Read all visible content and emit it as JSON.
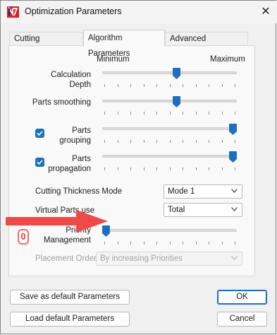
{
  "window": {
    "title": "Optimization Parameters",
    "close_glyph": "✕"
  },
  "tabs": [
    {
      "label": "Cutting Parameters",
      "active": false
    },
    {
      "label": "Algorithm Parameters",
      "active": true
    },
    {
      "label": "Advanced Parameters",
      "active": false
    }
  ],
  "scale": {
    "min_label": "Minimum",
    "max_label": "Maximum"
  },
  "sliders": {
    "calculation_depth": {
      "label_line1": "Calculation",
      "label_line2": "Depth",
      "value_fraction": 0.55
    },
    "parts_smoothing": {
      "label": "Parts smoothing",
      "value_fraction": 0.55
    },
    "parts_grouping": {
      "label_line1": "Parts",
      "label_line2": "grouping",
      "checked": true,
      "value_fraction": 1.0
    },
    "parts_propagation": {
      "label_line1": "Parts",
      "label_line2": "propagation",
      "checked": true,
      "value_fraction": 1.0
    },
    "priority_management": {
      "label_line1": "Priority",
      "label_line2": "Management",
      "value_fraction": 0.0
    }
  },
  "fields": {
    "cutting_thickness_mode": {
      "label": "Cutting Thickness Mode",
      "value": "Mode 1"
    },
    "virtual_parts_use": {
      "label": "Virtual Parts use",
      "value": "Total"
    },
    "placement_order": {
      "label": "Placement Order",
      "value": "By increasing Priorities",
      "disabled": true
    }
  },
  "annotation": {
    "badge_text": "0",
    "arrow_color": "#ef4a4a"
  },
  "buttons": {
    "save_default": "Save as default Parameters",
    "load_default": "Load default Parameters",
    "ok": "OK",
    "cancel": "Cancel"
  },
  "colors": {
    "accent": "#1f6fbf",
    "annotation": "#ef4a4a"
  }
}
